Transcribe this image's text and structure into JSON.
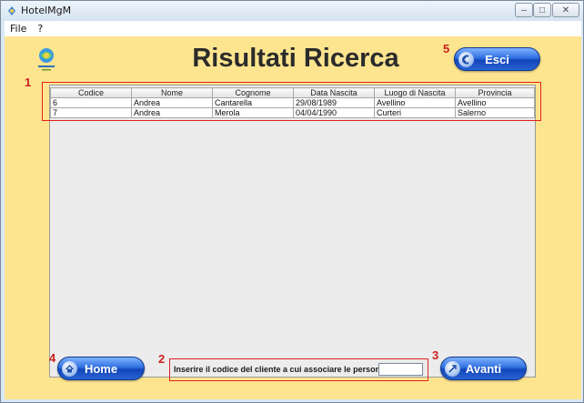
{
  "window": {
    "title": "HotelMgM",
    "controls": {
      "minimize": "–",
      "maximize": "□",
      "close": "✕"
    }
  },
  "menu": {
    "items": [
      "File",
      "?"
    ]
  },
  "logo": {
    "icon": "hotel-logo"
  },
  "page": {
    "title": "Risultati Ricerca"
  },
  "buttons": {
    "exit_label": "Esci",
    "home_label": "Home",
    "next_label": "Avanti"
  },
  "table": {
    "columns": [
      "Codice",
      "Nome",
      "Cognome",
      "Data Nascita",
      "Luogo di Nascita",
      "Provincia"
    ],
    "rows": [
      [
        "6",
        "Andrea",
        "Cantarella",
        "29/08/1989",
        "Avellino",
        "Avellino"
      ],
      [
        "7",
        "Andrea",
        "Merola",
        "04/04/1990",
        "Curteri",
        "Salerno"
      ]
    ]
  },
  "code_entry": {
    "label": "Inserire il codice del cliente a cui associare le persone:",
    "value": ""
  },
  "markers": [
    "1",
    "2",
    "3",
    "4",
    "5"
  ],
  "colors": {
    "background": "#fde590",
    "marker": "#cc1f1f",
    "button_blue": "#2f6fe0"
  }
}
